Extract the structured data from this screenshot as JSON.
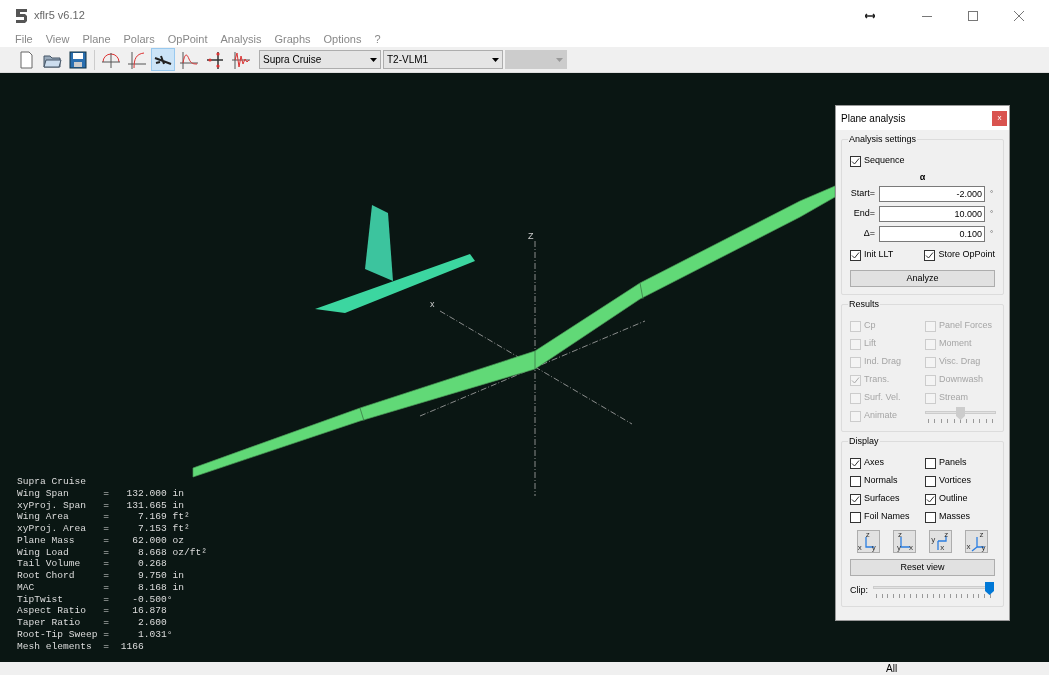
{
  "window": {
    "title": "xflr5 v6.12"
  },
  "menu": [
    "File",
    "View",
    "Plane",
    "Polars",
    "OpPoint",
    "Analysis",
    "Graphs",
    "Options",
    "?"
  ],
  "toolbar": {
    "tools": [
      {
        "kind": "new",
        "selected": false
      },
      {
        "kind": "open",
        "selected": false
      },
      {
        "kind": "save",
        "selected": false
      },
      {
        "kind": "polar",
        "selected": false
      },
      {
        "kind": "curve",
        "selected": false
      },
      {
        "kind": "plane",
        "selected": true
      },
      {
        "kind": "cp",
        "selected": false
      },
      {
        "kind": "stability",
        "selected": false
      },
      {
        "kind": "time",
        "selected": false
      }
    ],
    "combos": [
      {
        "value": "Supra Cruise",
        "disabled": false
      },
      {
        "value": "T2-VLM1",
        "disabled": false
      },
      {
        "disabled": true
      }
    ]
  },
  "view": {
    "axis_labels": [
      "Z",
      "x"
    ],
    "info": [
      "Supra Cruise",
      "Wing Span      =   132.000 in",
      "xyProj. Span   =   131.665 in",
      "Wing Area      =     7.169 ft²",
      "xyProj. Area   =     7.153 ft²",
      "Plane Mass     =    62.000 oz",
      "Wing Load      =     8.668 oz/ft²",
      "Tail Volume    =     0.268",
      "Root Chord     =     9.750 in",
      "MAC            =     8.168 in",
      "TipTwist       =    -0.500°",
      "Aspect Ratio   =    16.878",
      "Taper Ratio    =     2.600",
      "Root-Tip Sweep =     1.031°",
      "Mesh elements  =  1166"
    ]
  },
  "panel": {
    "title": "Plane analysis",
    "close": "x",
    "settings": {
      "title": "Analysis settings",
      "sequence": {
        "label": "Sequence",
        "checked": true
      },
      "symbol": "α",
      "fields": [
        {
          "label": "Start=",
          "value": "-2.000",
          "unit": "°"
        },
        {
          "label": "End=",
          "value": "10.000",
          "unit": "°"
        },
        {
          "label": "Δ=",
          "value": "0.100",
          "unit": "°"
        }
      ],
      "options": [
        {
          "label": "Init LLT",
          "checked": true
        },
        {
          "label": "Store OpPoint",
          "checked": true
        }
      ],
      "button": "Analyze"
    },
    "results": {
      "title": "Results",
      "items": [
        {
          "label": "Cp",
          "checked": false,
          "disabled": true
        },
        {
          "label": "Panel Forces",
          "checked": false,
          "disabled": true
        },
        {
          "label": "Lift",
          "checked": false,
          "disabled": true
        },
        {
          "label": "Moment",
          "checked": false,
          "disabled": true
        },
        {
          "label": "Ind. Drag",
          "checked": false,
          "disabled": true
        },
        {
          "label": "Visc. Drag",
          "checked": false,
          "disabled": true
        },
        {
          "label": "Trans.",
          "checked": true,
          "disabled": true
        },
        {
          "label": "Downwash",
          "checked": false,
          "disabled": true
        },
        {
          "label": "Surf. Vel.",
          "checked": false,
          "disabled": true
        },
        {
          "label": "Stream",
          "checked": false,
          "disabled": true
        }
      ],
      "animate": {
        "label": "Animate",
        "checked": false,
        "disabled": true
      },
      "speed": {
        "level": 0.5,
        "disabled": true
      }
    },
    "display": {
      "title": "Display",
      "items": [
        {
          "label": "Axes",
          "checked": true
        },
        {
          "label": "Panels",
          "checked": false
        },
        {
          "label": "Normals",
          "checked": false
        },
        {
          "label": "Vortices",
          "checked": false
        },
        {
          "label": "Surfaces",
          "checked": true
        },
        {
          "label": "Outline",
          "checked": true
        },
        {
          "label": "Foil Names",
          "checked": false
        },
        {
          "label": "Masses",
          "checked": false
        }
      ],
      "views": [
        {
          "labels": [
            "z",
            "x",
            "y"
          ]
        },
        {
          "labels": [
            "z",
            "y",
            "x"
          ]
        },
        {
          "labels": [
            "y",
            "z",
            "x"
          ]
        },
        {
          "labels": [
            "z",
            "x",
            "y"
          ]
        }
      ],
      "reset": "Reset view",
      "clip": {
        "label": "Clip:",
        "level": 1.0
      }
    }
  },
  "status_bar": {
    "text": "All"
  }
}
